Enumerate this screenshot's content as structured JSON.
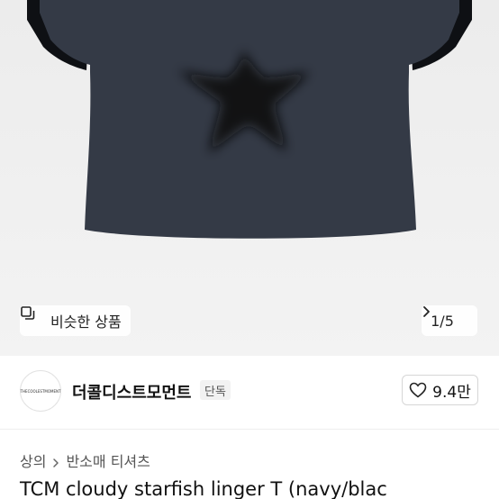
{
  "gallery": {
    "similar_label": "비슷한 상품",
    "pager_text": "1/5",
    "shirt_colors": {
      "body": "#343a46",
      "trim": "#0e1014",
      "print": "#111111"
    }
  },
  "store": {
    "avatar_text": "THECOOLESTMOMENT",
    "name": "더콜디스트모먼트",
    "badge": "단독",
    "likes": "9.4만"
  },
  "breadcrumb": {
    "level1": "상의",
    "level2": "반소매 티셔츠"
  },
  "product": {
    "title": "TCM cloudy starfish linger T (navy/blac"
  }
}
